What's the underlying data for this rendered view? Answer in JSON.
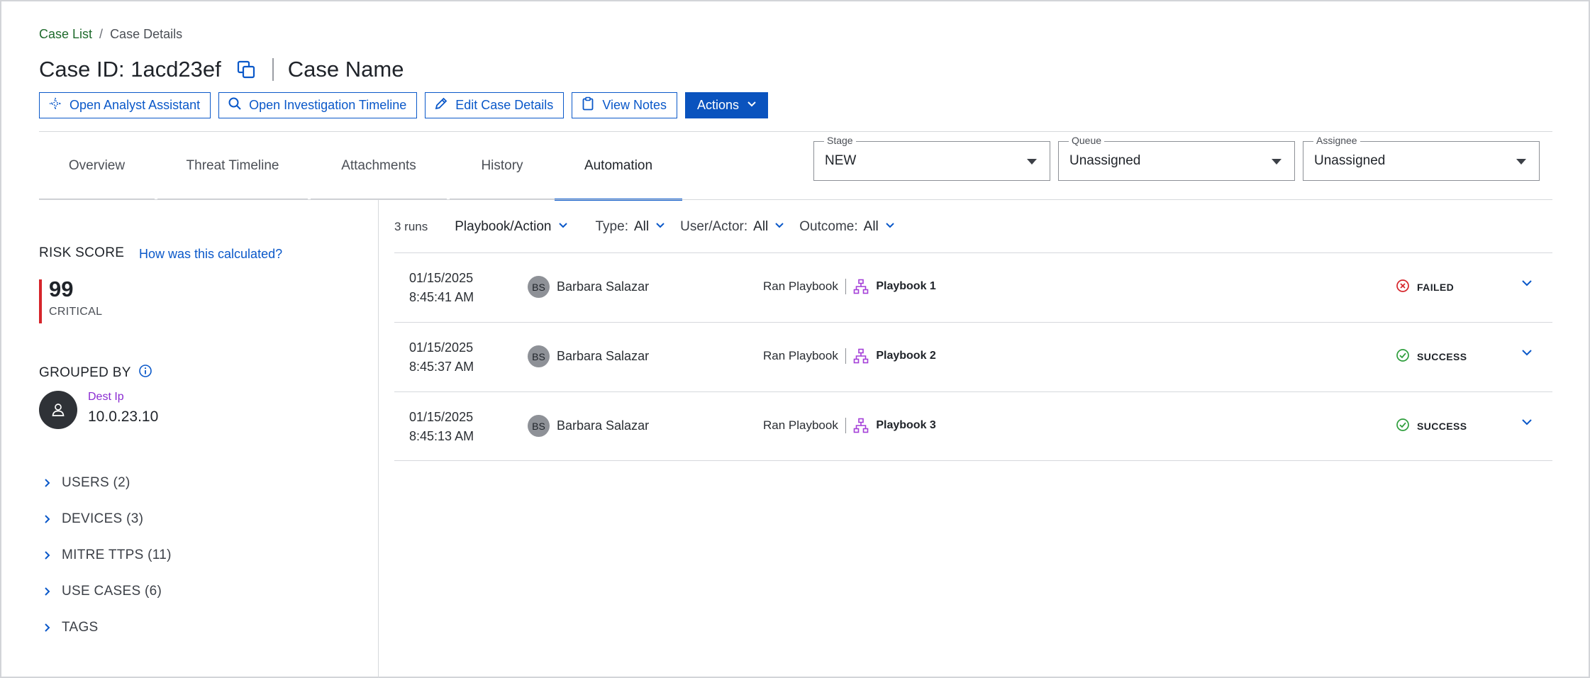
{
  "breadcrumb": {
    "parent": "Case List",
    "separator": "/",
    "current": "Case Details"
  },
  "header": {
    "case_id": "Case ID: 1acd23ef",
    "case_name": "Case Name"
  },
  "toolbar": {
    "analyst": "Open Analyst Assistant",
    "timeline": "Open Investigation Timeline",
    "edit": "Edit Case Details",
    "notes": "View Notes",
    "actions": "Actions"
  },
  "tabs": [
    {
      "label": "Overview"
    },
    {
      "label": "Threat Timeline"
    },
    {
      "label": "Attachments"
    },
    {
      "label": "History"
    },
    {
      "label": "Automation",
      "active": true
    }
  ],
  "selects": {
    "stage": {
      "label": "Stage",
      "value": "NEW"
    },
    "queue": {
      "label": "Queue",
      "value": "Unassigned"
    },
    "assignee": {
      "label": "Assignee",
      "value": "Unassigned"
    }
  },
  "risk": {
    "label": "RISK SCORE",
    "link": "How was this calculated?",
    "score": "99",
    "level": "CRITICAL",
    "color": "#d6252b"
  },
  "grouped": {
    "label": "GROUPED BY",
    "key": "Dest Ip",
    "value": "10.0.23.10"
  },
  "sections": [
    {
      "label": "USERS (2)"
    },
    {
      "label": "DEVICES (3)"
    },
    {
      "label": "MITRE TTPS (11)"
    },
    {
      "label": "USE CASES (6)"
    },
    {
      "label": "TAGS"
    }
  ],
  "filters": {
    "runs": "3 runs",
    "playbook": "Playbook/Action",
    "type_label": "Type:",
    "type_value": "All",
    "user_label": "User/Actor:",
    "user_value": "All",
    "outcome_label": "Outcome:",
    "outcome_value": "All"
  },
  "runs": [
    {
      "date": "01/15/2025",
      "time": "8:45:41 AM",
      "initials": "BS",
      "user": "Barbara Salazar",
      "action": "Ran Playbook",
      "playbook": "Playbook 1",
      "outcome": "FAILED",
      "status": "failed"
    },
    {
      "date": "01/15/2025",
      "time": "8:45:37 AM",
      "initials": "BS",
      "user": "Barbara Salazar",
      "action": "Ran Playbook",
      "playbook": "Playbook 2",
      "outcome": "SUCCESS",
      "status": "success"
    },
    {
      "date": "01/15/2025",
      "time": "8:45:13 AM",
      "initials": "BS",
      "user": "Barbara Salazar",
      "action": "Ran Playbook",
      "playbook": "Playbook 3",
      "outcome": "SUCCESS",
      "status": "success"
    }
  ],
  "colors": {
    "accent": "#0a58c9",
    "failed": "#d6252b",
    "success": "#2e9e3c",
    "playbook_icon": "#a43fd8",
    "link_green": "#1e6a2c"
  }
}
